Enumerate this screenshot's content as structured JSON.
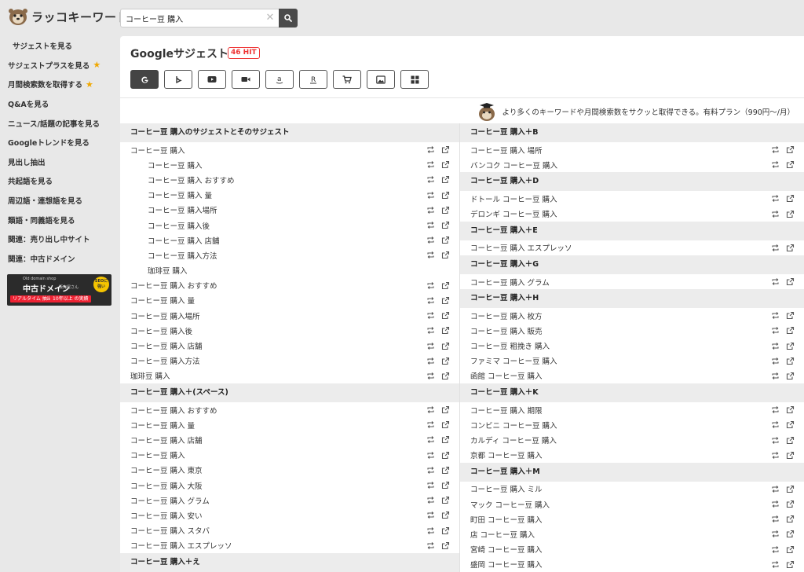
{
  "app": {
    "logo_text": "ラッコキーワード"
  },
  "search": {
    "value": "コーヒー豆 購入",
    "clear_glyph": "✕"
  },
  "sidebar": {
    "items": [
      {
        "label": "サジェストを見る",
        "active": true,
        "star": false
      },
      {
        "label": "サジェストプラスを見る",
        "star": true
      },
      {
        "label": "月間検索数を取得する",
        "star": true
      },
      {
        "label": "Q&Aを見る",
        "star": false
      },
      {
        "label": "ニュース/話題の記事を見る",
        "star": false
      },
      {
        "label": "Googleトレンドを見る",
        "star": false
      },
      {
        "label": "見出し抽出",
        "star": false
      },
      {
        "label": "共起語を見る",
        "star": false
      },
      {
        "label": "周辺語・連想語を見る",
        "star": false
      },
      {
        "label": "類語・同義語を見る",
        "star": false
      },
      {
        "label": "関連：売り出し中サイト",
        "star": false
      },
      {
        "label": "関連：中古ドメイン",
        "star": false
      }
    ],
    "star_glyph": "★",
    "banner": {
      "top": "Old domain shop",
      "title": "中古ドメイン",
      "sub": "販売屋さん",
      "tag1": "リアルタイム 抽出",
      "tag2": "10年以上 の実績",
      "badge": "SEOに 強い"
    }
  },
  "main": {
    "title": "Googleサジェスト",
    "hit_badge": "46 HIT",
    "engine_tabs": [
      "google-icon",
      "bing-icon",
      "youtube-icon",
      "video-icon",
      "amazon-icon",
      "rakuten-icon",
      "cart-icon",
      "image-icon",
      "grid-icon"
    ],
    "promo_text": "より多くのキーワードや月間検索数をサクッと取得できる。有料プラン（990円〜/月）",
    "left_sections": [
      {
        "heading": "コーヒー豆 購入のサジェストとそのサジェスト",
        "rows": [
          {
            "text": "コーヒー豆 購入",
            "sub": false
          },
          {
            "text": "コーヒー豆 購入",
            "sub": true
          },
          {
            "text": "コーヒー豆 購入 おすすめ",
            "sub": true
          },
          {
            "text": "コーヒー豆 購入 量",
            "sub": true
          },
          {
            "text": "コーヒー豆 購入場所",
            "sub": true
          },
          {
            "text": "コーヒー豆 購入後",
            "sub": true
          },
          {
            "text": "コーヒー豆 購入 店舗",
            "sub": true
          },
          {
            "text": "コーヒー豆 購入方法",
            "sub": true
          },
          {
            "text": "珈琲豆 購入",
            "sub": true,
            "no_icons": true
          },
          {
            "text": "コーヒー豆 購入 おすすめ",
            "sub": false
          },
          {
            "text": "コーヒー豆 購入 量",
            "sub": false
          },
          {
            "text": "コーヒー豆 購入場所",
            "sub": false
          },
          {
            "text": "コーヒー豆 購入後",
            "sub": false
          },
          {
            "text": "コーヒー豆 購入 店舗",
            "sub": false
          },
          {
            "text": "コーヒー豆 購入方法",
            "sub": false
          },
          {
            "text": "珈琲豆 購入",
            "sub": false
          }
        ]
      },
      {
        "heading": "コーヒー豆 購入＋(スペース)",
        "rows": [
          {
            "text": "コーヒー豆 購入 おすすめ"
          },
          {
            "text": "コーヒー豆 購入 量"
          },
          {
            "text": "コーヒー豆 購入 店舗"
          },
          {
            "text": "コーヒー豆 購入"
          },
          {
            "text": "コーヒー豆 購入 東京"
          },
          {
            "text": "コーヒー豆 購入 大阪"
          },
          {
            "text": "コーヒー豆 購入 グラム"
          },
          {
            "text": "コーヒー豆 購入 安い"
          },
          {
            "text": "コーヒー豆 購入 スタバ"
          },
          {
            "text": "コーヒー豆 購入 エスプレッソ"
          }
        ]
      },
      {
        "heading": "コーヒー豆 購入＋え",
        "rows": []
      }
    ],
    "right_sections": [
      {
        "heading": "コーヒー豆 購入＋B",
        "rows": [
          {
            "text": "コーヒー豆 購入 場所"
          },
          {
            "text": "バンコク コーヒー豆 購入"
          }
        ]
      },
      {
        "heading": "コーヒー豆 購入＋D",
        "rows": [
          {
            "text": "ドトール コーヒー豆 購入"
          },
          {
            "text": "デロンギ コーヒー豆 購入"
          }
        ]
      },
      {
        "heading": "コーヒー豆 購入＋E",
        "rows": [
          {
            "text": "コーヒー豆 購入 エスプレッソ"
          }
        ]
      },
      {
        "heading": "コーヒー豆 購入＋G",
        "rows": [
          {
            "text": "コーヒー豆 購入 グラム"
          }
        ]
      },
      {
        "heading": "コーヒー豆 購入＋H",
        "rows": [
          {
            "text": "コーヒー豆 購入 枚方"
          },
          {
            "text": "コーヒー豆 購入 販売"
          },
          {
            "text": "コーヒー豆 粗挽き 購入"
          },
          {
            "text": "ファミマ コーヒー豆 購入"
          },
          {
            "text": "函館 コーヒー豆 購入"
          }
        ]
      },
      {
        "heading": "コーヒー豆 購入＋K",
        "rows": [
          {
            "text": "コーヒー豆 購入 期限"
          },
          {
            "text": "コンビニ コーヒー豆 購入"
          },
          {
            "text": "カルディ コーヒー豆 購入"
          },
          {
            "text": "京都 コーヒー豆 購入"
          }
        ]
      },
      {
        "heading": "コーヒー豆 購入＋M",
        "rows": [
          {
            "text": "コーヒー豆 購入 ミル"
          },
          {
            "text": "マック コーヒー豆 購入"
          },
          {
            "text": "町田 コーヒー豆 購入"
          },
          {
            "text": "店 コーヒー豆 購入"
          },
          {
            "text": "宮崎 コーヒー豆 購入"
          },
          {
            "text": "盛岡 コーヒー豆 購入"
          }
        ]
      }
    ]
  }
}
